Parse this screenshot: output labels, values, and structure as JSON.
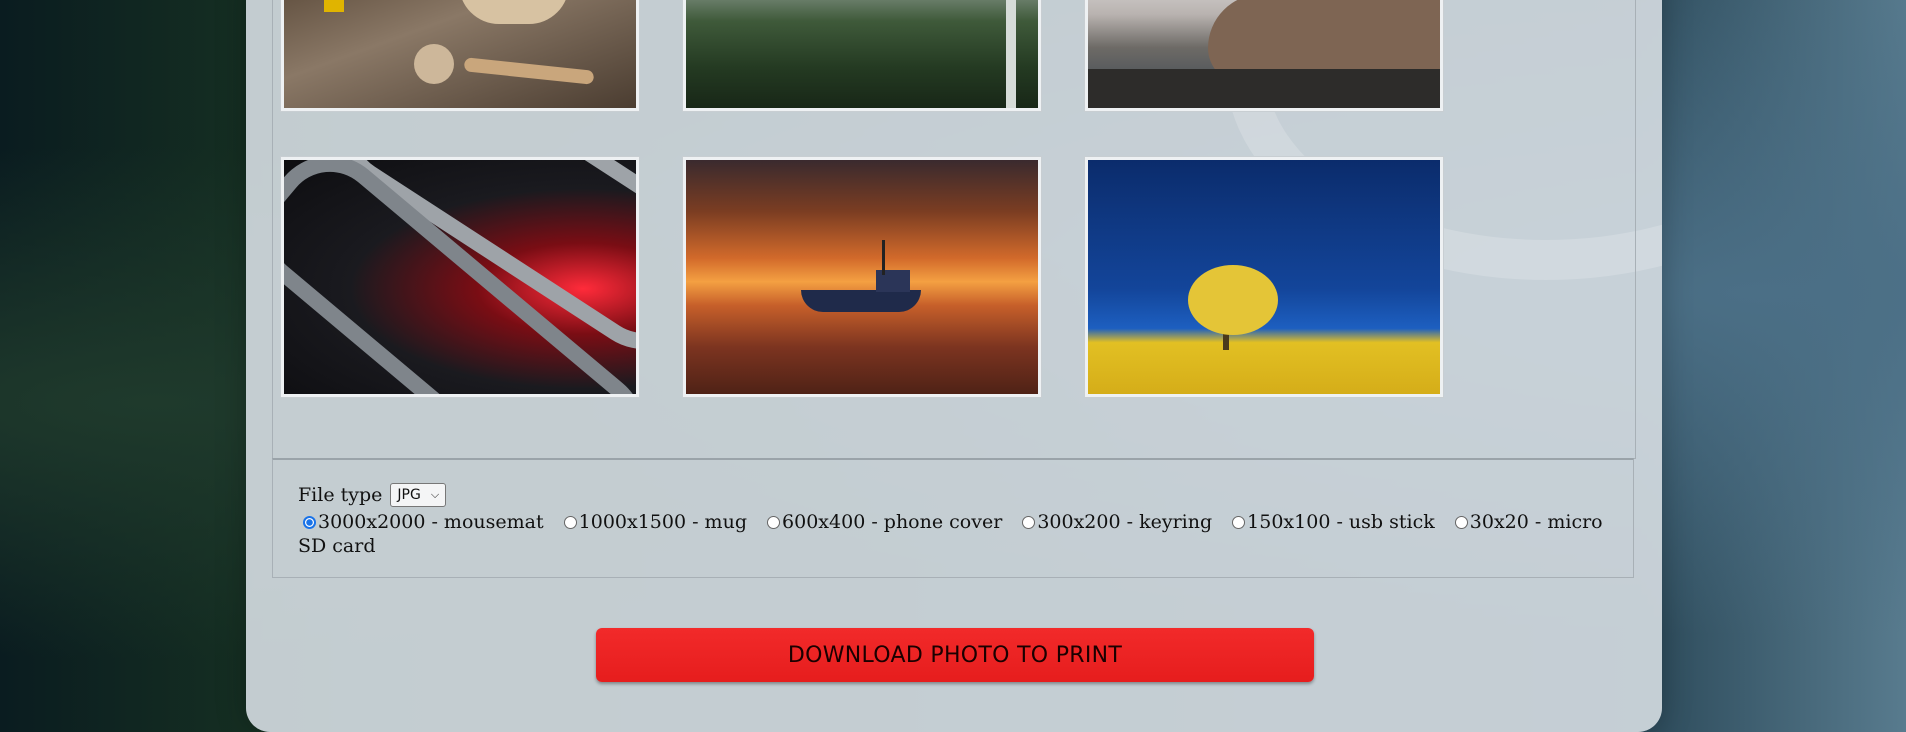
{
  "gallery": {
    "photos": [
      {
        "name": "tools-photo"
      },
      {
        "name": "greenhouse-photo"
      },
      {
        "name": "coast-photo"
      },
      {
        "name": "red-abstract-photo"
      },
      {
        "name": "sunset-boat-photo"
      },
      {
        "name": "yellow-tree-photo"
      }
    ]
  },
  "options": {
    "file_type_label": "File type",
    "file_type_value": "JPG",
    "sizes": [
      {
        "label": "3000x2000 - mousemat",
        "checked": true
      },
      {
        "label": "1000x1500 - mug",
        "checked": false
      },
      {
        "label": "600x400 - phone cover",
        "checked": false
      },
      {
        "label": "300x200 - keyring",
        "checked": false
      },
      {
        "label": "150x100 - usb stick",
        "checked": false
      },
      {
        "label": "30x20 - micro SD card",
        "checked": false
      }
    ]
  },
  "download_button": "DOWNLOAD PHOTO TO PRINT",
  "colors": {
    "accent_red": "#e61d1d",
    "radio_blue": "#1a73e8"
  }
}
